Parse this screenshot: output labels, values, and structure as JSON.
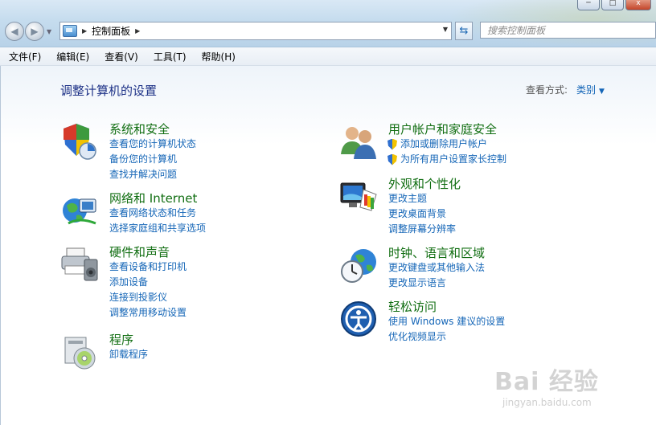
{
  "window": {
    "minimize": "─",
    "maximize": "□",
    "close": "x"
  },
  "address_bar": {
    "breadcrumb": "控制面板"
  },
  "search": {
    "placeholder": "搜索控制面板"
  },
  "menu": [
    "文件(F)",
    "编辑(E)",
    "查看(V)",
    "工具(T)",
    "帮助(H)"
  ],
  "main": {
    "title": "调整计算机的设置",
    "view_by_label": "查看方式:",
    "view_by_value": "类别"
  },
  "categories": {
    "system_security": {
      "title": "系统和安全",
      "icon": "shield-pie-icon",
      "links": [
        "查看您的计算机状态",
        "备份您的计算机",
        "查找并解决问题"
      ]
    },
    "network": {
      "title": "网络和 Internet",
      "icon": "globe-network-icon",
      "links": [
        "查看网络状态和任务",
        "选择家庭组和共享选项"
      ]
    },
    "hardware_sound": {
      "title": "硬件和声音",
      "icon": "printer-speaker-icon",
      "links": [
        "查看设备和打印机",
        "添加设备",
        "连接到投影仪",
        "调整常用移动设置"
      ]
    },
    "programs": {
      "title": "程序",
      "icon": "programs-disc-icon",
      "links": [
        "卸载程序"
      ]
    },
    "user_accounts": {
      "title": "用户帐户和家庭安全",
      "icon": "users-icon",
      "links": [
        "添加或删除用户帐户",
        "为所有用户设置家长控制"
      ]
    },
    "appearance": {
      "title": "外观和个性化",
      "icon": "monitor-palette-icon",
      "links": [
        "更改主题",
        "更改桌面背景",
        "调整屏幕分辨率"
      ]
    },
    "clock_region": {
      "title": "时钟、语言和区域",
      "icon": "clock-globe-icon",
      "links": [
        "更改键盘或其他输入法",
        "更改显示语言"
      ]
    },
    "ease_access": {
      "title": "轻松访问",
      "icon": "ease-of-access-icon",
      "links": [
        "使用 Windows 建议的设置",
        "优化视频显示"
      ]
    }
  },
  "watermark": {
    "main": "Bai 经验",
    "sub": "jingyan.baidu.com"
  }
}
